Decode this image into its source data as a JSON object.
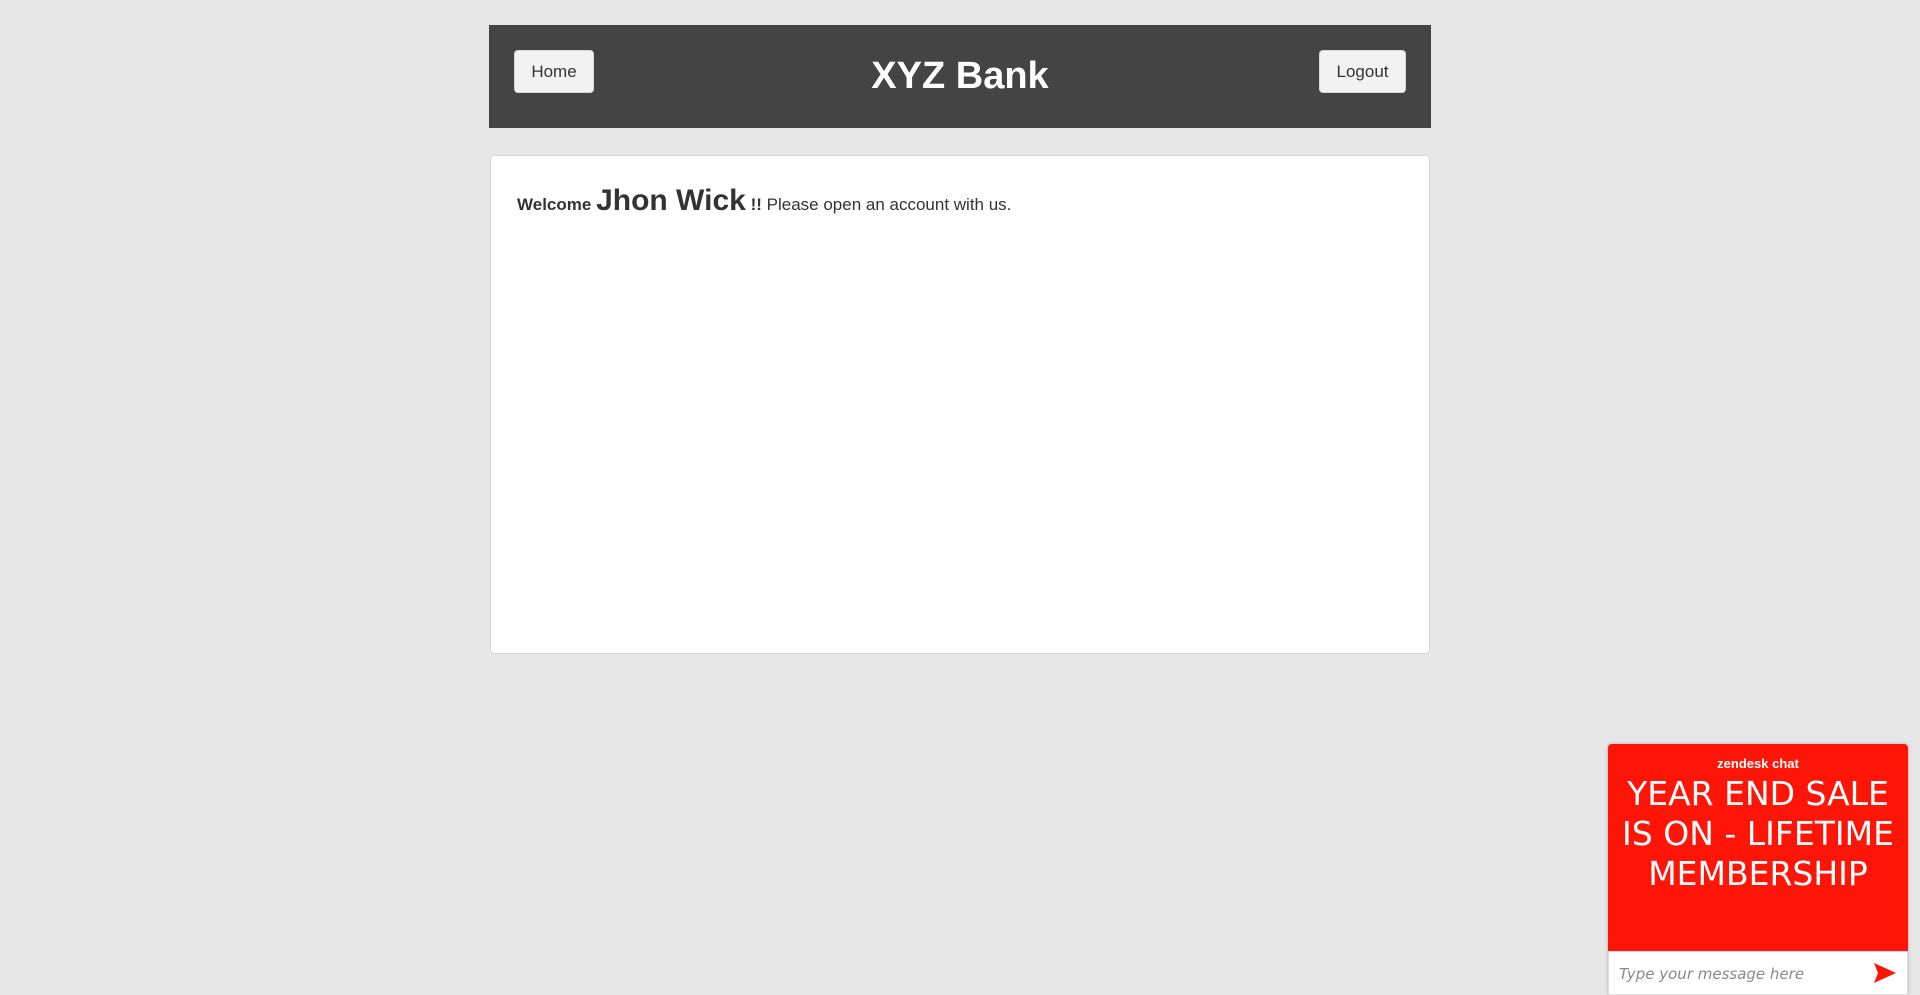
{
  "header": {
    "home_label": "Home",
    "title": "XYZ Bank",
    "logout_label": "Logout"
  },
  "main": {
    "welcome_word": "Welcome",
    "user_name": "Jhon Wick",
    "exclaim": "!!",
    "message": "Please open an account with us."
  },
  "chat": {
    "brand": "zendesk chat",
    "promo": "YEAR END SALE IS ON - LIFETIME MEMBERSHIP",
    "input_placeholder": "Type your message here",
    "send_icon": "send-arrow-icon",
    "accent_color": "#fe1507"
  },
  "colors": {
    "page_background": "#e7e7e7",
    "header_background": "#444444",
    "panel_background": "#ffffff"
  }
}
